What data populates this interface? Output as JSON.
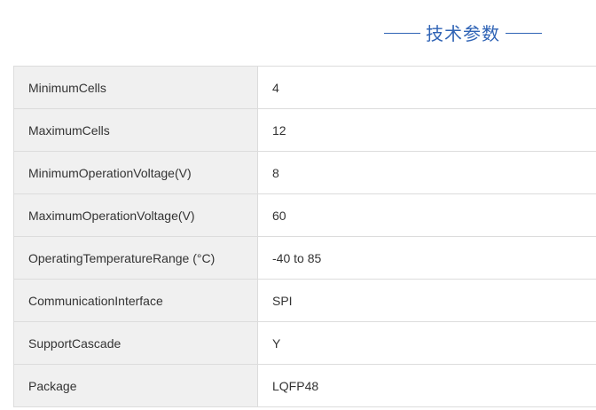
{
  "section": {
    "title": "技术参数"
  },
  "specs": [
    {
      "name": "MinimumCells",
      "value": "4"
    },
    {
      "name": "MaximumCells",
      "value": "12"
    },
    {
      "name": "MinimumOperationVoltage(V)",
      "value": "8"
    },
    {
      "name": "MaximumOperationVoltage(V)",
      "value": "60"
    },
    {
      "name": "OperatingTemperatureRange (°C)",
      "value": "-40 to 85"
    },
    {
      "name": "CommunicationInterface",
      "value": "SPI"
    },
    {
      "name": "SupportCascade",
      "value": "Y"
    },
    {
      "name": "Package",
      "value": "LQFP48"
    }
  ]
}
